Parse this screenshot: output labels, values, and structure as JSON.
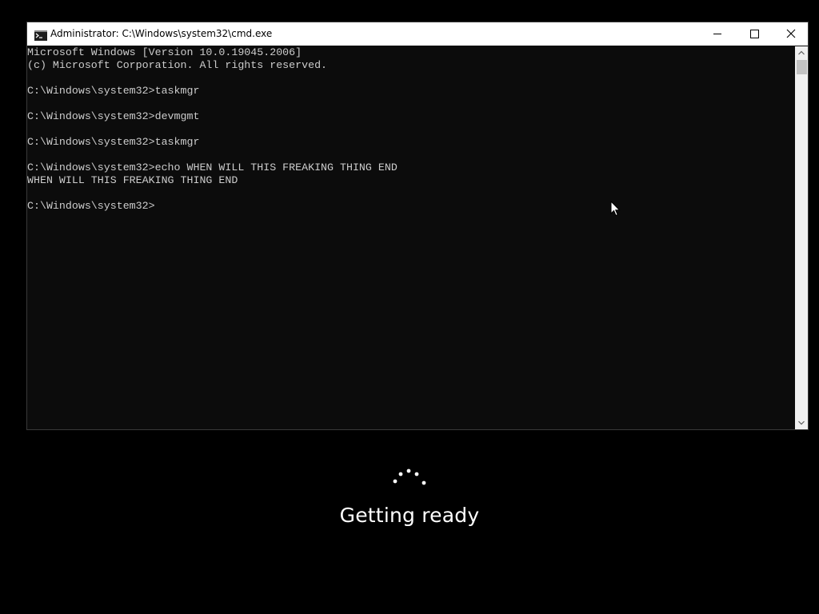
{
  "window": {
    "title": "Administrator: C:\\Windows\\system32\\cmd.exe",
    "icon": "cmd-icon",
    "controls": {
      "minimize_icon": "minimize-icon",
      "maximize_icon": "maximize-icon",
      "close_icon": "close-icon"
    }
  },
  "console": {
    "lines": [
      "Microsoft Windows [Version 10.0.19045.2006]",
      "(c) Microsoft Corporation. All rights reserved.",
      "",
      "C:\\Windows\\system32>taskmgr",
      "",
      "C:\\Windows\\system32>devmgmt",
      "",
      "C:\\Windows\\system32>taskmgr",
      "",
      "C:\\Windows\\system32>echo WHEN WILL THIS FREAKING THING END",
      "WHEN WILL THIS FREAKING THING END",
      "",
      "C:\\Windows\\system32>"
    ],
    "background_color": "#0c0c0c",
    "text_color": "#cccccc"
  },
  "overlay": {
    "status_text": "Getting ready",
    "spinner_icon": "loading-dots-icon"
  },
  "colors": {
    "screen_background": "#000000",
    "titlebar": "#ffffff"
  }
}
